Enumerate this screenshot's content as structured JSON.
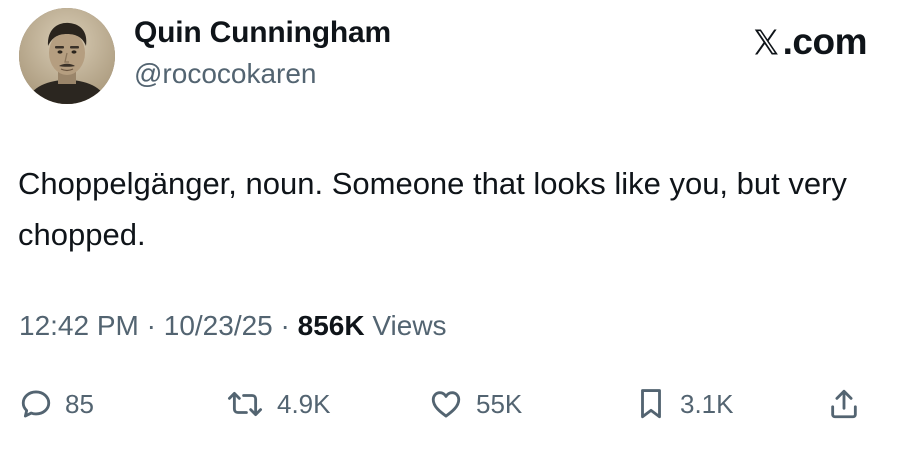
{
  "author": {
    "name": "Quin Cunningham",
    "handle": "@rococokaren",
    "avatar_icon": "profile-photo"
  },
  "brand": {
    "label": ".com",
    "logo_icon": "x-logo-icon"
  },
  "tweet": {
    "text": "Choppelgänger, noun. Someone that looks like you, but very chopped."
  },
  "meta": {
    "time": "12:42 PM",
    "separator": " · ",
    "date": "10/23/25",
    "views_count": "856K",
    "views_label": " Views"
  },
  "actions": {
    "reply": {
      "icon": "reply-icon",
      "count": "85"
    },
    "repost": {
      "icon": "repost-icon",
      "count": "4.9K"
    },
    "like": {
      "icon": "heart-icon",
      "count": "55K"
    },
    "bookmark": {
      "icon": "bookmark-icon",
      "count": "3.1K"
    },
    "share": {
      "icon": "share-icon"
    }
  },
  "colors": {
    "text_primary": "#0f1419",
    "text_secondary": "#536471",
    "background": "#ffffff"
  }
}
